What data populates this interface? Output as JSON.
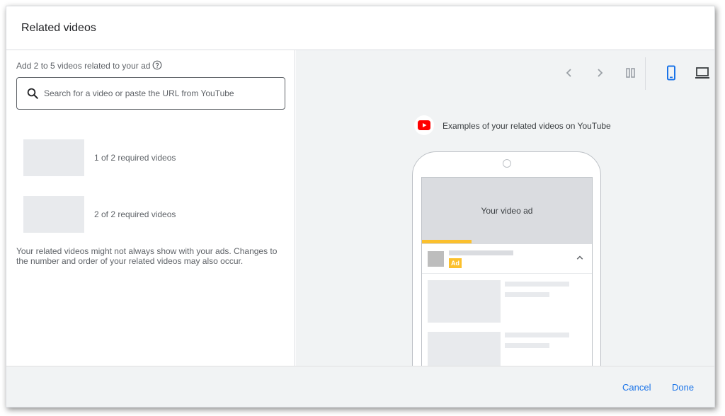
{
  "dialog": {
    "title": "Related videos"
  },
  "left_panel": {
    "add_label": "Add 2 to 5 videos related to your ad",
    "help_icon": "help-circle-icon",
    "search": {
      "placeholder": "Search for a video or paste the URL from YouTube",
      "value": "",
      "icon": "search-icon"
    },
    "slots": [
      {
        "label": "1 of 2 required videos"
      },
      {
        "label": "2 of 2 required videos"
      }
    ],
    "note": "Your related videos might not always show with your ads. Changes to the number and order of your related videos may also occur."
  },
  "preview": {
    "toolbar": {
      "icons": [
        "chevron-left-icon",
        "chevron-right-icon",
        "pause-columns-icon",
        "phone-icon",
        "laptop-icon"
      ],
      "active": "phone-icon"
    },
    "youtube_label": "Examples of your related videos on YouTube",
    "video_ad_label": "Your video ad",
    "ad_badge": "Ad"
  },
  "footer": {
    "cancel_label": "Cancel",
    "done_label": "Done"
  },
  "colors": {
    "accent": "#1a73e8",
    "youtube_red": "#ff0000",
    "ad_yellow": "#fbc02d",
    "panel_gray": "#f1f3f4"
  }
}
